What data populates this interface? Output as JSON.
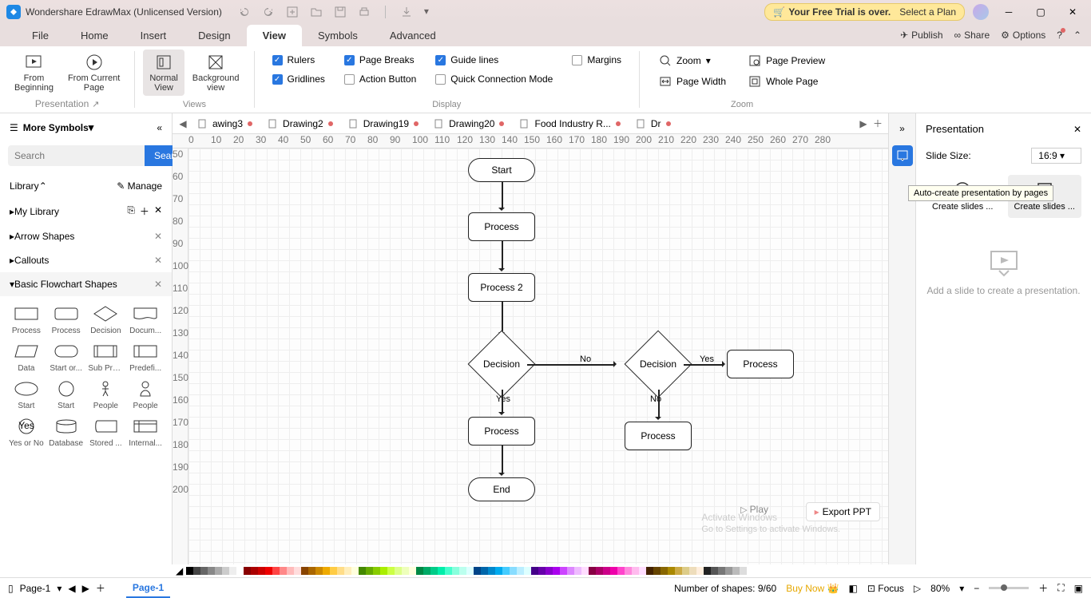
{
  "titlebar": {
    "app_title": "Wondershare EdrawMax (Unlicensed Version)",
    "trial": "Your Free Trial is over.",
    "trial_cta": "Select a Plan"
  },
  "menus": [
    "File",
    "Home",
    "Insert",
    "Design",
    "View",
    "Symbols",
    "Advanced"
  ],
  "menu_active": 4,
  "menu_right": {
    "publish": "Publish",
    "share": "Share",
    "options": "Options"
  },
  "ribbon": {
    "presentation": {
      "from_beginning": "From\nBeginning",
      "from_current": "From Current\nPage",
      "label": "Presentation"
    },
    "views": {
      "normal": "Normal\nView",
      "background": "Background\nview",
      "label": "Views"
    },
    "display": {
      "rulers": "Rulers",
      "page_breaks": "Page Breaks",
      "guide_lines": "Guide lines",
      "margins": "Margins",
      "gridlines": "Gridlines",
      "action_button": "Action Button",
      "quick_conn": "Quick Connection Mode",
      "checked": {
        "rulers": true,
        "page_breaks": true,
        "guide_lines": true,
        "margins": false,
        "gridlines": true,
        "action_button": false,
        "quick_conn": false
      },
      "label": "Display"
    },
    "zoom": {
      "zoom": "Zoom",
      "page_preview": "Page Preview",
      "page_width": "Page Width",
      "whole_page": "Whole Page",
      "label": "Zoom"
    }
  },
  "left": {
    "more_symbols": "More Symbols",
    "search_placeholder": "Search",
    "search_btn": "Search",
    "library": "Library",
    "manage": "Manage",
    "sections": [
      "My Library",
      "Arrow Shapes",
      "Callouts",
      "Basic Flowchart Shapes"
    ],
    "open_section": 3,
    "shapes": [
      "Process",
      "Process",
      "Decision",
      "Docum...",
      "Data",
      "Start or...",
      "Sub Pro...",
      "Predefi...",
      "Start",
      "Start",
      "People",
      "People",
      "Yes or No",
      "Database",
      "Stored ...",
      "Internal..."
    ]
  },
  "tabs": [
    "awing3",
    "Drawing2",
    "Drawing19",
    "Drawing20",
    "Food Industry R...",
    "Dr"
  ],
  "ruler_h": [
    "0",
    "10",
    "20",
    "30",
    "40",
    "50",
    "60",
    "70",
    "80",
    "90",
    "100",
    "110",
    "120",
    "130",
    "140",
    "150",
    "160",
    "170",
    "180",
    "190",
    "200",
    "210",
    "220",
    "230",
    "240",
    "250",
    "260",
    "270",
    "280"
  ],
  "ruler_v": [
    "50",
    "60",
    "70",
    "80",
    "90",
    "100",
    "110",
    "120",
    "130",
    "140",
    "150",
    "160",
    "170",
    "180",
    "190",
    "200"
  ],
  "flow": {
    "start": "Start",
    "process": "Process",
    "process2": "Process 2",
    "decision": "Decision",
    "decision2": "Decision",
    "process3": "Process",
    "end": "End",
    "process_r": "Process",
    "process_b": "Process",
    "yes": "Yes",
    "no": "No",
    "yes2": "Yes",
    "no2": "No"
  },
  "right": {
    "title": "Presentation",
    "slide_size_lbl": "Slide Size:",
    "slide_size_val": "16:9",
    "create_slides": "Create slides ...",
    "create_slides2": "Create slides ...",
    "tooltip": "Auto-create presentation by pages",
    "empty": "Add a slide to create a presentation."
  },
  "export_ppt": "Export PPT",
  "play": "Play",
  "watermark": {
    "l1": "Activate Windows",
    "l2": "Go to Settings to activate Windows."
  },
  "status": {
    "page": "Page-1",
    "page_tab": "Page-1",
    "shapes": "Number of shapes: 9/60",
    "buy": "Buy Now",
    "focus": "Focus",
    "zoom": "80%"
  },
  "colors": [
    "#000",
    "#444",
    "#666",
    "#888",
    "#aaa",
    "#ccc",
    "#eee",
    "#fff",
    "#800",
    "#a00",
    "#c00",
    "#e00",
    "#f44",
    "#f88",
    "#fbb",
    "#fdd",
    "#840",
    "#a60",
    "#c80",
    "#ea0",
    "#fc4",
    "#fd8",
    "#feb",
    "#ffd",
    "#480",
    "#6a0",
    "#8c0",
    "#ae0",
    "#cf4",
    "#df8",
    "#efb",
    "#ffd",
    "#084",
    "#0a6",
    "#0c8",
    "#0ea",
    "#4fc",
    "#8fd",
    "#bfe",
    "#dff",
    "#048",
    "#06a",
    "#08c",
    "#0ae",
    "#4cf",
    "#8df",
    "#bef",
    "#dff",
    "#408",
    "#60a",
    "#80c",
    "#a0e",
    "#c4f",
    "#d8f",
    "#ebf",
    "#fdf",
    "#804",
    "#a06",
    "#c08",
    "#e0a",
    "#f4c",
    "#f8d",
    "#fbe",
    "#fdf",
    "#420",
    "#640",
    "#860",
    "#a80",
    "#ca4",
    "#dc8",
    "#edb",
    "#fed",
    "#222",
    "#555",
    "#777",
    "#999",
    "#bbb",
    "#ddd"
  ]
}
